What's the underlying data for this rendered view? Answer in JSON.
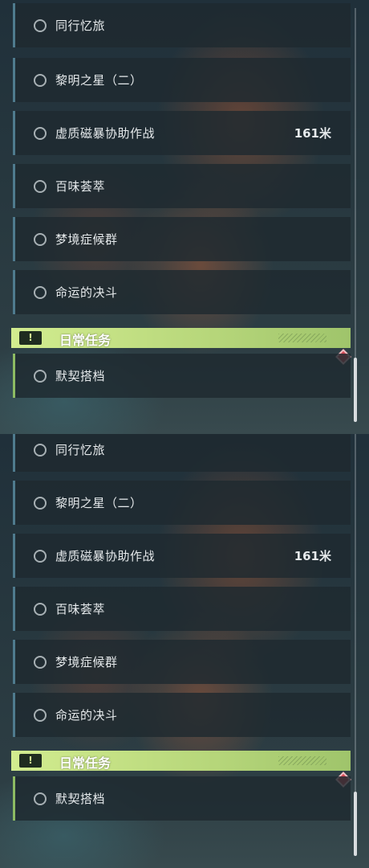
{
  "panels": [
    {
      "tasks": [
        {
          "label": "同行忆旅",
          "distance": ""
        },
        {
          "label": "黎明之星（二）",
          "distance": ""
        },
        {
          "label": "虚质磁暴协助作战",
          "distance": "161米"
        },
        {
          "label": "百味荟萃",
          "distance": ""
        },
        {
          "label": "梦境症候群",
          "distance": ""
        },
        {
          "label": "命运的决斗",
          "distance": ""
        }
      ],
      "daily_header": {
        "title": "日常任务",
        "icon": "exclamation-icon"
      },
      "daily_tasks": [
        {
          "label": "默契搭档"
        }
      ]
    },
    {
      "tasks": [
        {
          "label": "同行忆旅",
          "distance": ""
        },
        {
          "label": "黎明之星（二）",
          "distance": ""
        },
        {
          "label": "虚质磁暴协助作战",
          "distance": "161米"
        },
        {
          "label": "百味荟萃",
          "distance": ""
        },
        {
          "label": "梦境症候群",
          "distance": ""
        },
        {
          "label": "命运的决斗",
          "distance": ""
        }
      ],
      "daily_header": {
        "title": "日常任务",
        "icon": "exclamation-icon"
      },
      "daily_tasks": [
        {
          "label": "默契搭档"
        }
      ]
    }
  ],
  "colors": {
    "task_accent": "#4f7b8e",
    "daily_accent": "#8dbb63",
    "header_bg": "#d2ec8f",
    "marker": "#d64b57"
  }
}
